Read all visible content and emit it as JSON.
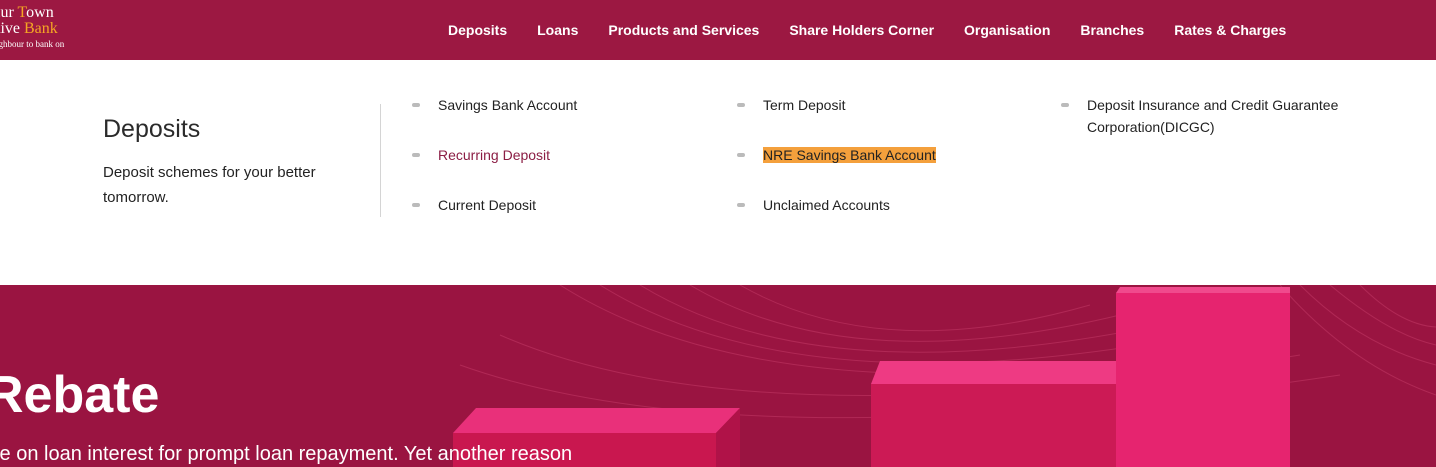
{
  "logo": {
    "line1_a": "lur ",
    "line1_b": "T",
    "line1_c": "own",
    "line2_a": "tive ",
    "line2_b": "Bank",
    "tagline": "ighbour to bank on"
  },
  "nav": {
    "items": [
      "Deposits",
      "Loans",
      "Products and Services",
      "Share Holders Corner",
      "Organisation",
      "Branches",
      "Rates & Charges"
    ]
  },
  "mega_menu": {
    "title": "Deposits",
    "description": "Deposit schemes for your better tomorrow.",
    "links": [
      "Savings Bank Account",
      "Recurring Deposit",
      "Current Deposit",
      "Term Deposit",
      "NRE Savings Bank Account",
      "Unclaimed Accounts",
      "Deposit Insurance and Credit Guarantee Corporation(DICGC)"
    ]
  },
  "hero": {
    "title": "Rebate",
    "subtitle": "te on loan interest for prompt loan repayment. Yet another reason"
  },
  "colors": {
    "brand": "#9c1842",
    "accent": "#f5a623",
    "highlight": "#f4a03c",
    "hero_bar": "#e6246f"
  }
}
